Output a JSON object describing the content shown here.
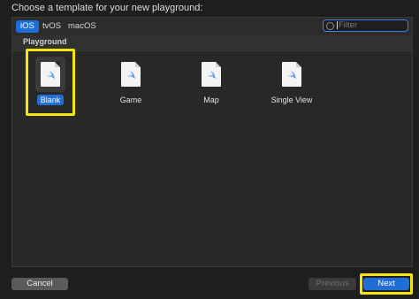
{
  "dialog": {
    "prompt": "Choose a template for your new playground:"
  },
  "tabs": [
    {
      "label": "iOS",
      "active": true
    },
    {
      "label": "tvOS",
      "active": false
    },
    {
      "label": "macOS",
      "active": false
    }
  ],
  "filter": {
    "placeholder": "Filter",
    "icon": "filter-icon"
  },
  "section": {
    "label": "Playground"
  },
  "templates": [
    {
      "label": "Blank",
      "icon": "swift-file-icon",
      "selected": true
    },
    {
      "label": "Game",
      "icon": "swift-file-icon",
      "selected": false
    },
    {
      "label": "Map",
      "icon": "swift-file-icon",
      "selected": false
    },
    {
      "label": "Single View",
      "icon": "swift-file-icon",
      "selected": false
    }
  ],
  "buttons": {
    "cancel": "Cancel",
    "previous": "Previous",
    "next": "Next"
  },
  "colors": {
    "accent": "#1f6ed6",
    "highlight": "#f4e50b",
    "swift": "#3b8ee8"
  }
}
